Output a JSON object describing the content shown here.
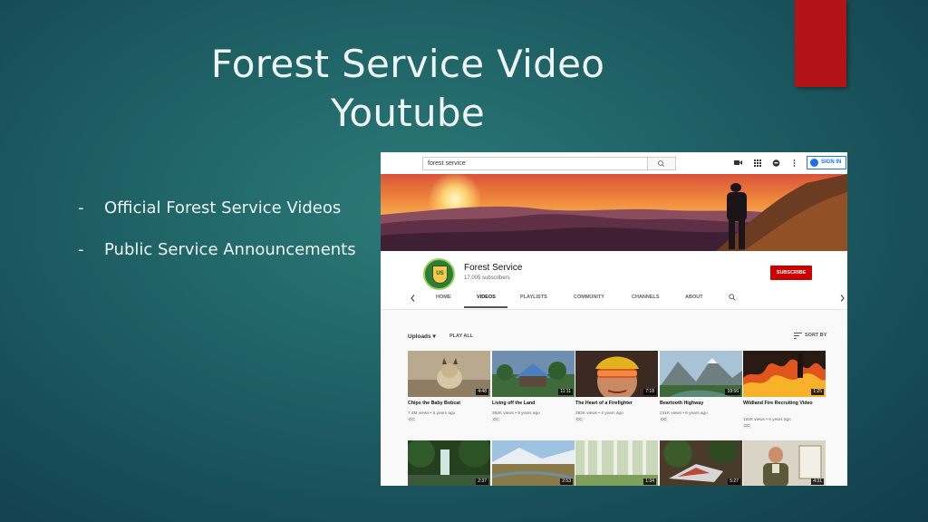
{
  "slide": {
    "title_line1": "Forest Service Video",
    "title_line2": "Youtube",
    "bullets": [
      {
        "dash": "-",
        "text": "Official Forest Service Videos"
      },
      {
        "dash": "-",
        "text": "Public Service Announcements"
      }
    ],
    "accent_color": "#b31217"
  },
  "youtube": {
    "search": {
      "value": "forest service",
      "icon": "search-icon"
    },
    "header_icons": [
      "video-camera-icon",
      "apps-grid-icon",
      "messages-icon",
      "more-vertical-icon"
    ],
    "signin_label": "SIGN IN",
    "channel": {
      "logo_text": "US",
      "name": "Forest Service",
      "subscribers": "17,005 subscribers",
      "subscribe_label": "SUBSCRIBE"
    },
    "tabs": [
      "HOME",
      "VIDEOS",
      "PLAYLISTS",
      "COMMUNITY",
      "CHANNELS",
      "ABOUT"
    ],
    "active_tab": "VIDEOS",
    "uploads_label": "Uploads ▾",
    "play_all_label": "PLAY ALL",
    "sort_label": "SORT BY",
    "videos_row1": [
      {
        "title": "Chips the Baby Bobcat",
        "meta": "7.4M views • 5 years ago",
        "cc": "CC",
        "duration": "4:48"
      },
      {
        "title": "Living off the Land",
        "meta": "362K views • 9 years ago",
        "cc": "CC",
        "duration": "11:11"
      },
      {
        "title": "The Heart of a Firefighter",
        "meta": "282K views • 4 years ago",
        "cc": "CC",
        "duration": "7:18"
      },
      {
        "title": "Beartooth Highway",
        "meta": "231K views • 6 years ago",
        "cc": "CC",
        "duration": "19:56"
      },
      {
        "title": "Wildland Fire Recruiting Video",
        "meta": "122K views • 6 years ago",
        "cc": "CC",
        "duration": "1:25"
      }
    ],
    "videos_row2": [
      {
        "duration": "2:37"
      },
      {
        "duration": "2:53"
      },
      {
        "duration": "1:34"
      },
      {
        "duration": "5:27"
      },
      {
        "duration": "4:31"
      }
    ],
    "colors": {
      "subscribe": "#cc0000",
      "signin": "#1a73e8"
    }
  }
}
